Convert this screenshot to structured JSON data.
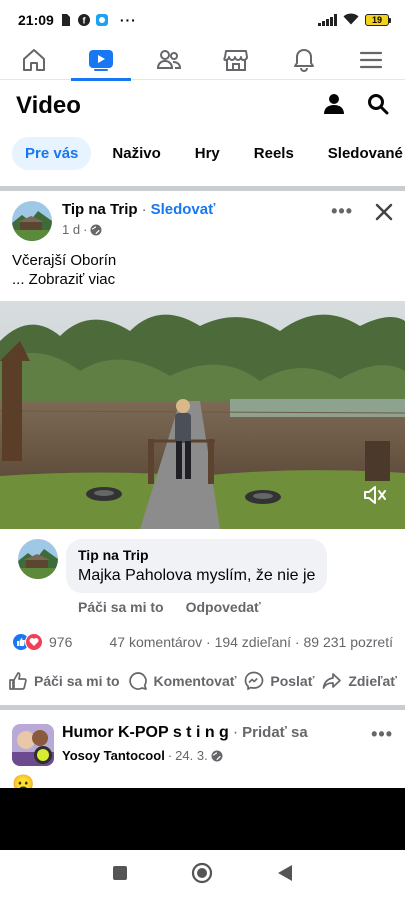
{
  "status_bar": {
    "time": "21:09",
    "battery": "19"
  },
  "top_nav": {
    "active": "video"
  },
  "header": {
    "title": "Video"
  },
  "tabs": [
    {
      "label": "Pre vás"
    },
    {
      "label": "Naživo"
    },
    {
      "label": "Hry"
    },
    {
      "label": "Reels"
    },
    {
      "label": "Sledované"
    }
  ],
  "post": {
    "author": "Tip na Trip",
    "separator": "·",
    "follow_label": "Sledovať",
    "time": "1 d",
    "audience": "public",
    "text_line1": "Včerajší Oborín",
    "see_more": "... Zobraziť viac"
  },
  "comment": {
    "author": "Tip na Trip",
    "text": "Majka Paholova myslím, že nie je",
    "like_label": "Páči sa mi to",
    "reply_label": "Odpovedať"
  },
  "stats": {
    "reactions_count": "976",
    "summary": "47 komentárov · 194 zdieľaní · 89 231 pozretí"
  },
  "actions": {
    "like": "Páči sa mi to",
    "comment": "Komentovať",
    "send": "Poslať",
    "share": "Zdieľať"
  },
  "post2": {
    "group": "Humor K-POP s t i n g",
    "separator": "·",
    "join_label": "Pridať sa",
    "author": "Yosoy Tantocool",
    "separator2": "·",
    "date": "24. 3.",
    "emoji": "😦"
  },
  "colors": {
    "accent": "#1877f2",
    "secondary_text": "#65676b",
    "bubble": "#f0f2f5"
  }
}
